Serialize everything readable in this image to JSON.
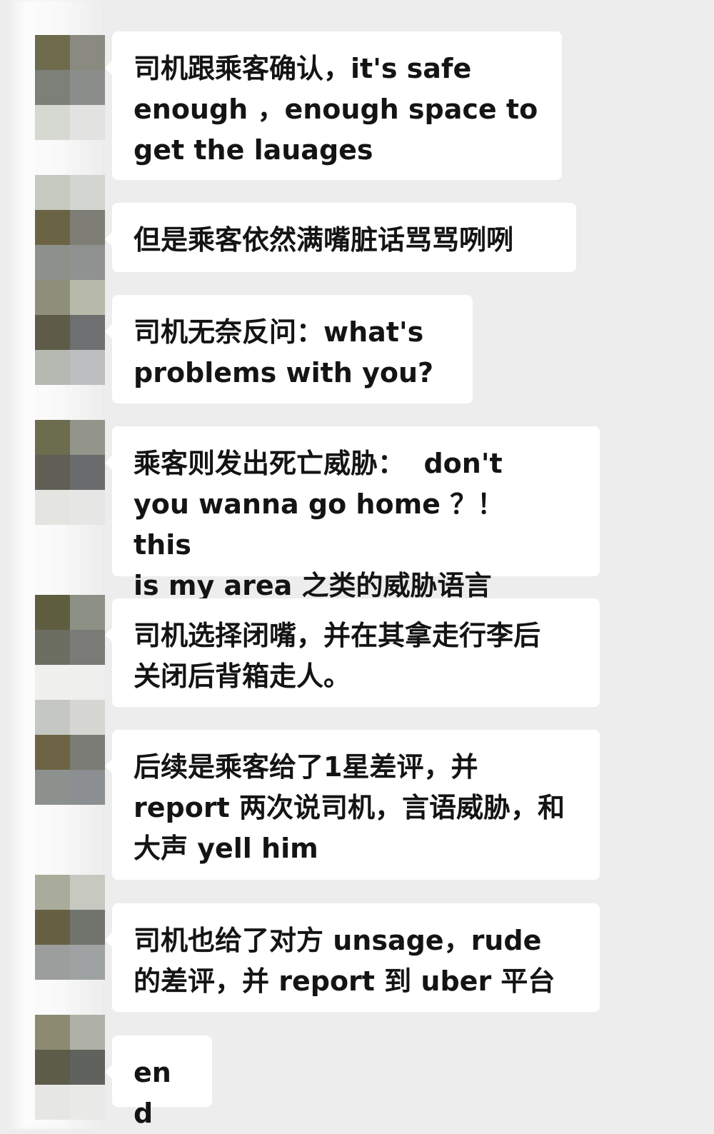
{
  "messages": [
    {
      "text": "司机跟乘客确认，it's safe\nenough ，enough space to\nget the lauages"
    },
    {
      "text": "但是乘客依然满嘴脏话骂骂咧咧"
    },
    {
      "text": "司机无奈反问：what's\nproblems with you?"
    },
    {
      "text": "乘客则发出死亡威胁：  don't\nyou wanna go home ？！  this\nis my area 之类的威胁语言"
    },
    {
      "text": "司机选择闭嘴，并在其拿走行李后\n关闭后背箱走人。"
    },
    {
      "text": "后续是乘客给了1星差评，并\nreport 两次说司机，言语威胁，和\n大声 yell him"
    },
    {
      "text": "司机也给了对方 unsage，rude\n的差评，并 report 到 uber 平台"
    },
    {
      "text": "end"
    }
  ],
  "colors": {
    "background": "#ededed",
    "bubble": "#ffffff",
    "text": "#141414"
  },
  "icons": {
    "avatar": "pixelated-avatar-icon"
  }
}
